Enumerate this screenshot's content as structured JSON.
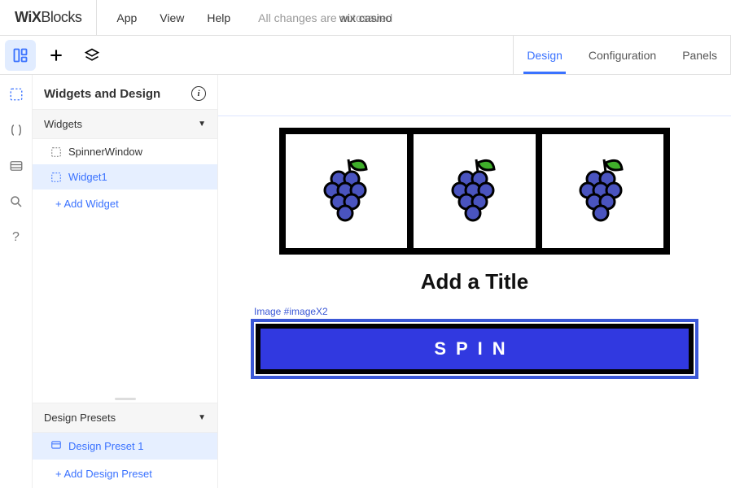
{
  "logo": {
    "bold": "WiX",
    "light": "Blocks"
  },
  "topmenu": {
    "app": "App",
    "view": "View",
    "help": "Help"
  },
  "autosave_text": "All changes are autosaved",
  "project_name": "wix casino",
  "tabs": {
    "design": "Design",
    "configuration": "Configuration",
    "panels": "Panels"
  },
  "panel": {
    "title": "Widgets and Design",
    "widgets_section": "Widgets",
    "items": [
      {
        "label": "SpinnerWindow"
      },
      {
        "label": "Widget1"
      }
    ],
    "add_widget": "+ Add Widget",
    "presets_section": "Design Presets",
    "preset_items": [
      {
        "label": "Design Preset 1"
      }
    ],
    "add_preset": "+ Add Design Preset"
  },
  "canvas": {
    "title_placeholder": "Add a Title",
    "selection_label": "Image #imageX2",
    "spin_label": "SPIN"
  }
}
